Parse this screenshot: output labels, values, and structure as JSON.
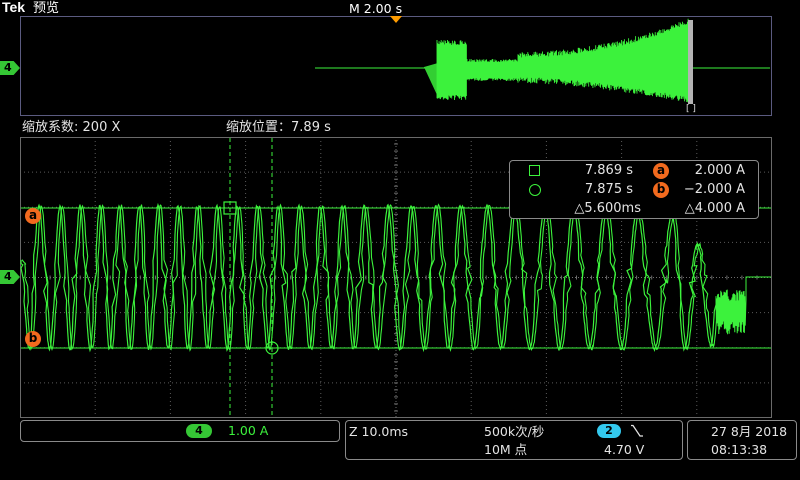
{
  "header": {
    "brand": "Tek",
    "mode": "预览",
    "timebase": "M 2.00 s"
  },
  "overview": {
    "zoom_marker": "[ ]"
  },
  "zoom": {
    "factor_label": "缩放系数:",
    "factor_value": "200 X",
    "position_label": "缩放位置：",
    "position_value": "7.89 s"
  },
  "channel": {
    "number": "4",
    "scale": "1.00 A"
  },
  "cursors": {
    "a_label": "a",
    "b_label": "b",
    "rows": [
      {
        "time": "7.869 s",
        "marker": "a",
        "value": "2.000 A"
      },
      {
        "time": "7.875 s",
        "marker": "b",
        "value": "−2.000 A"
      }
    ],
    "delta_time": "△5.600ms",
    "delta_value": "△4.000 A"
  },
  "acquisition": {
    "zoom_timebase": "Z 10.0ms",
    "sample_rate": "500k次/秒",
    "record_length": "10M 点"
  },
  "trigger": {
    "source": "2",
    "level": "4.70 V"
  },
  "datetime": {
    "date": "27 8月 2018",
    "time": "08:13:38"
  },
  "icons": {
    "trigger_position": "trigger-position-icon",
    "channel_marker": "channel-marker-icon",
    "cursor_1": "square-cursor-icon",
    "cursor_2": "circle-cursor-icon",
    "trigger_slope": "falling-edge-icon"
  },
  "colors": {
    "trace": "#3cf23c",
    "channel_pill": "#35c735",
    "cursor_marker": "#f26a1e",
    "trigger_pill": "#33c9ee",
    "trigger_position": "#ff9c00",
    "frame": "#8a8a8a"
  }
}
